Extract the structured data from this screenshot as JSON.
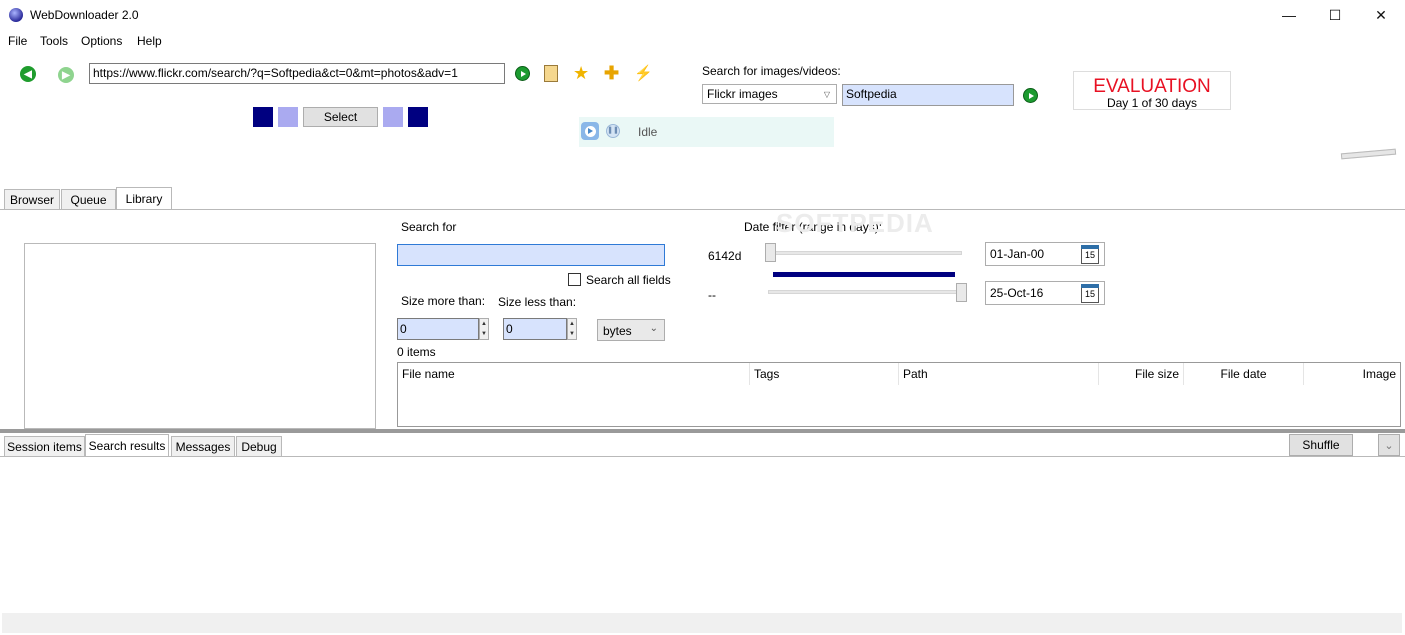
{
  "window": {
    "title": "WebDownloader 2.0",
    "minimize": "—",
    "maximize": "☐",
    "close": "✕"
  },
  "menu": [
    "File",
    "Tools",
    "Options",
    "Help"
  ],
  "toolbar": {
    "url": "https://www.flickr.com/search/?q=Softpedia&ct=0&mt=photos&adv=1",
    "select_label": "Select"
  },
  "search_images": {
    "label": "Search for images/videos:",
    "provider": "Flickr images",
    "query": "Softpedia"
  },
  "status": {
    "text": "Idle"
  },
  "evaluation": {
    "title": "EVALUATION",
    "subtitle": "Day 1 of 30 days"
  },
  "main_tabs": [
    "Browser",
    "Queue",
    "Library"
  ],
  "library": {
    "search_label": "Search for",
    "search_value": "",
    "search_all_fields": "Search all fields",
    "size_more_label": "Size more than:",
    "size_less_label": "Size less than:",
    "size_more_value": "0",
    "size_less_value": "0",
    "unit": "bytes",
    "items_count": "0 items",
    "date_filter_label": "Date filter (range in days):",
    "range_from_label": "6142d",
    "range_to_label": "--",
    "date_from": "01-Jan-00",
    "date_to": "25-Oct-16",
    "calendar_day": "15",
    "columns": [
      "File name",
      "Tags",
      "Path",
      "File size",
      "File date",
      "Image"
    ]
  },
  "bottom_tabs": [
    "Session items",
    "Search results",
    "Messages",
    "Debug"
  ],
  "shuffle_label": "Shuffle",
  "watermark": "SOFTPEDIA",
  "colors": {
    "dark_square": "#000080",
    "light_square": "#aaaaf0",
    "eval_red": "#e81123",
    "range_bar": "#000080"
  }
}
